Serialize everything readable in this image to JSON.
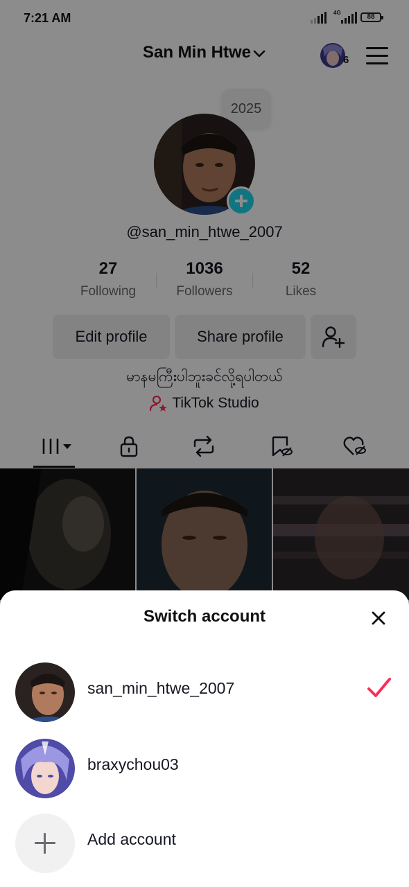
{
  "status_bar": {
    "time": "7:21 AM",
    "network": "4G",
    "battery": "88"
  },
  "header": {
    "username": "San Min Htwe",
    "notification_count": "6"
  },
  "profile": {
    "bubble_text": "2025",
    "handle": "@san_min_htwe_2007",
    "stats": [
      {
        "value": "27",
        "label": "Following"
      },
      {
        "value": "1036",
        "label": "Followers"
      },
      {
        "value": "52",
        "label": "Likes"
      }
    ],
    "buttons": {
      "edit": "Edit profile",
      "share": "Share profile"
    },
    "bio": "မာနမကြီးပါဘူးခင်လို့ရပါတယ်",
    "studio_link": "TikTok Studio"
  },
  "tabs": [
    "videos",
    "private",
    "reposts",
    "favorites",
    "liked"
  ],
  "sheet": {
    "title": "Switch account",
    "accounts": [
      {
        "name": "san_min_htwe_2007",
        "selected": true
      },
      {
        "name": "braxychou03",
        "selected": false
      }
    ],
    "add_label": "Add account"
  },
  "colors": {
    "accent": "#fe2c55",
    "teal": "#20d5ec",
    "text": "#161823",
    "muted": "#6b6b70"
  }
}
